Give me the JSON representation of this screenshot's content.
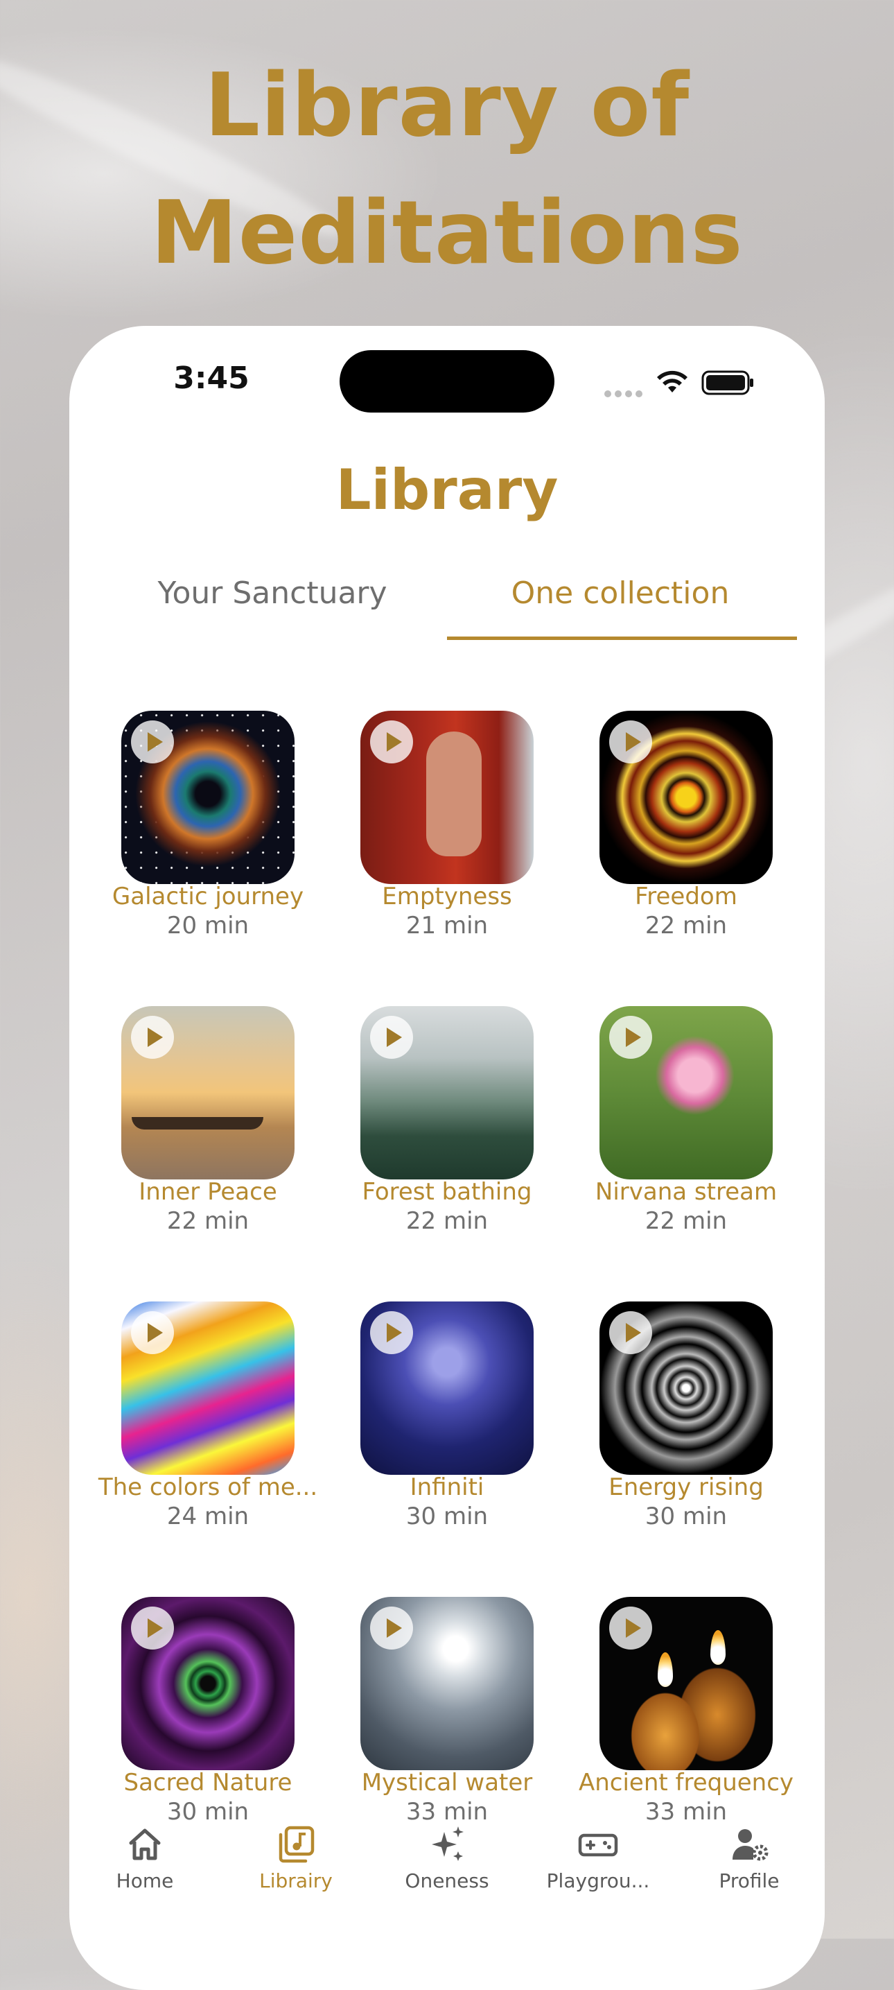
{
  "hero_title_line1": "Library of",
  "hero_title_line2": "Meditations",
  "status": {
    "time": "3:45"
  },
  "page_title": "Library",
  "tabs": [
    {
      "label": "Your Sanctuary",
      "active": false
    },
    {
      "label": "One collection",
      "active": true
    }
  ],
  "meditations": [
    {
      "title": "Galactic journey",
      "duration": "20 min"
    },
    {
      "title": "Emptyness",
      "duration": "21 min"
    },
    {
      "title": "Freedom",
      "duration": "22 min"
    },
    {
      "title": "Inner Peace",
      "duration": "22 min"
    },
    {
      "title": "Forest bathing",
      "duration": "22 min"
    },
    {
      "title": "Nirvana stream",
      "duration": "22 min"
    },
    {
      "title": "The colors of me...",
      "duration": "24 min"
    },
    {
      "title": "Infiniti",
      "duration": "30 min"
    },
    {
      "title": "Energy rising",
      "duration": "30 min"
    },
    {
      "title": "Sacred Nature",
      "duration": "30 min"
    },
    {
      "title": "Mystical water",
      "duration": "33 min"
    },
    {
      "title": "Ancient frequency",
      "duration": "33 min"
    }
  ],
  "nav": [
    {
      "label": "Home",
      "icon": "home-icon",
      "active": false
    },
    {
      "label": "Librairy",
      "icon": "music-library-icon",
      "active": true
    },
    {
      "label": "Oneness",
      "icon": "sparkles-icon",
      "active": false
    },
    {
      "label": "Playgrou...",
      "icon": "gamepad-icon",
      "active": false
    },
    {
      "label": "Profile",
      "icon": "profile-gear-icon",
      "active": false
    }
  ],
  "colors": {
    "accent": "#b5892f",
    "muted": "#6e6e6e",
    "inactive_icon": "#5a5a5a"
  }
}
